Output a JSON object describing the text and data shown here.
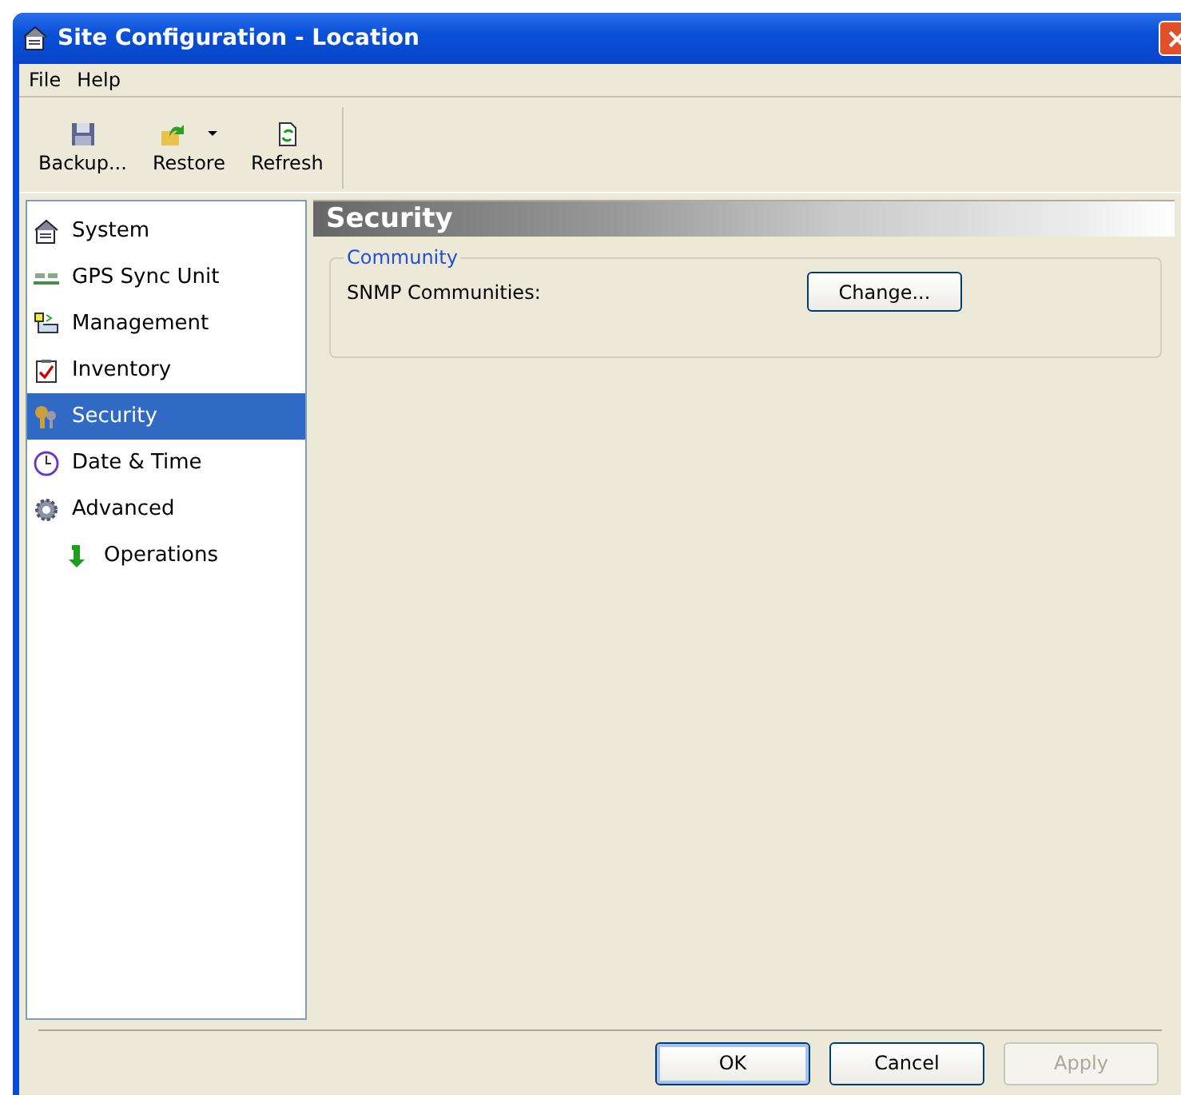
{
  "window": {
    "title": "Site Configuration - Location"
  },
  "menu": [
    "File",
    "Help"
  ],
  "toolbar": [
    {
      "label": "Backup...",
      "kind": "backup",
      "dropdown": false
    },
    {
      "label": "Restore",
      "kind": "restore",
      "dropdown": true
    },
    {
      "label": "Refresh",
      "kind": "refresh",
      "dropdown": false
    }
  ],
  "tree": [
    {
      "label": "System",
      "kind": "system",
      "selected": false
    },
    {
      "label": "GPS Sync Unit",
      "kind": "gps",
      "selected": false
    },
    {
      "label": "Management",
      "kind": "management",
      "selected": false
    },
    {
      "label": "Inventory",
      "kind": "inventory",
      "selected": false
    },
    {
      "label": "Security",
      "kind": "security",
      "selected": true
    },
    {
      "label": "Date & Time",
      "kind": "clock",
      "selected": false
    },
    {
      "label": "Advanced",
      "kind": "gear",
      "selected": false,
      "children": [
        {
          "label": "Operations",
          "kind": "arrow",
          "selected": false
        }
      ]
    }
  ],
  "panel": {
    "title": "Security",
    "group": "Community",
    "field_label": "SNMP Communities:",
    "button": "Change..."
  },
  "buttons": [
    {
      "label": "OK",
      "disabled": false,
      "default": true
    },
    {
      "label": "Cancel",
      "disabled": false,
      "default": false
    },
    {
      "label": "Apply",
      "disabled": true,
      "default": false
    }
  ]
}
